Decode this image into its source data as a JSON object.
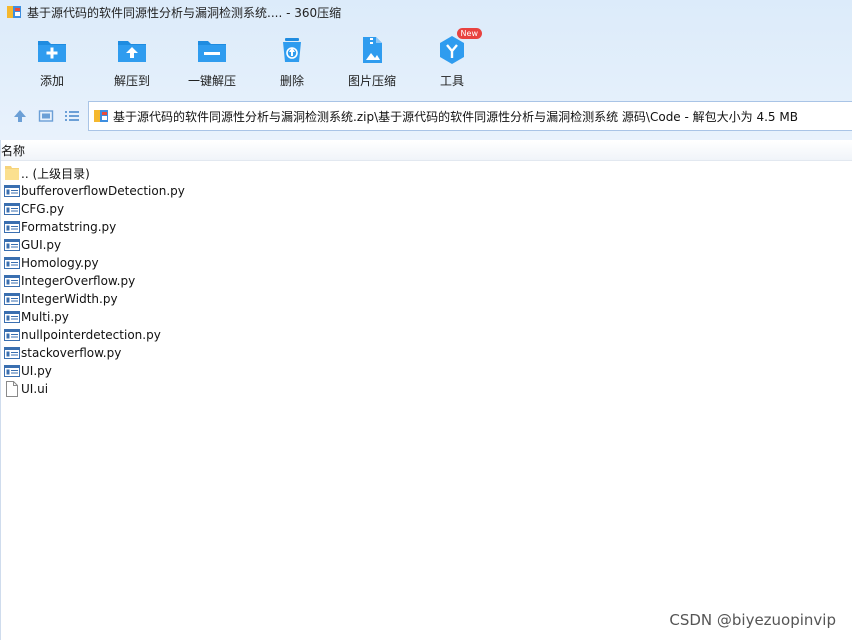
{
  "window": {
    "title": "基于源代码的软件同源性分析与漏洞检测系统.... - 360压缩"
  },
  "toolbar": {
    "items": [
      {
        "label": "添加",
        "icon": "add-folder-icon"
      },
      {
        "label": "解压到",
        "icon": "extract-to-icon"
      },
      {
        "label": "一键解压",
        "icon": "one-click-extract-icon"
      },
      {
        "label": "删除",
        "icon": "recycle-bin-icon"
      },
      {
        "label": "图片压缩",
        "icon": "image-compress-icon"
      },
      {
        "label": "工具",
        "icon": "tools-icon",
        "badge": "New"
      }
    ]
  },
  "address": {
    "path": "基于源代码的软件同源性分析与漏洞检测系统.zip\\基于源代码的软件同源性分析与漏洞检测系统 源码\\Code - 解包大小为 4.5 MB"
  },
  "columns": {
    "name": "名称"
  },
  "files": [
    {
      "name": ".. (上级目录)",
      "type": "parent-folder"
    },
    {
      "name": "bufferoverflowDetection.py",
      "type": "py"
    },
    {
      "name": "CFG.py",
      "type": "py"
    },
    {
      "name": "Formatstring.py",
      "type": "py"
    },
    {
      "name": "GUI.py",
      "type": "py"
    },
    {
      "name": "Homology.py",
      "type": "py"
    },
    {
      "name": "IntegerOverflow.py",
      "type": "py"
    },
    {
      "name": "IntegerWidth.py",
      "type": "py"
    },
    {
      "name": "Multi.py",
      "type": "py"
    },
    {
      "name": "nullpointerdetection.py",
      "type": "py"
    },
    {
      "name": "stackoverflow.py",
      "type": "py"
    },
    {
      "name": "UI.py",
      "type": "py"
    },
    {
      "name": "UI.ui",
      "type": "file"
    }
  ],
  "watermark": "CSDN @biyezuopinvip",
  "colors": {
    "accent": "#1f8ce0",
    "header_bg": "#dcebfa",
    "badge": "#e8423f"
  }
}
